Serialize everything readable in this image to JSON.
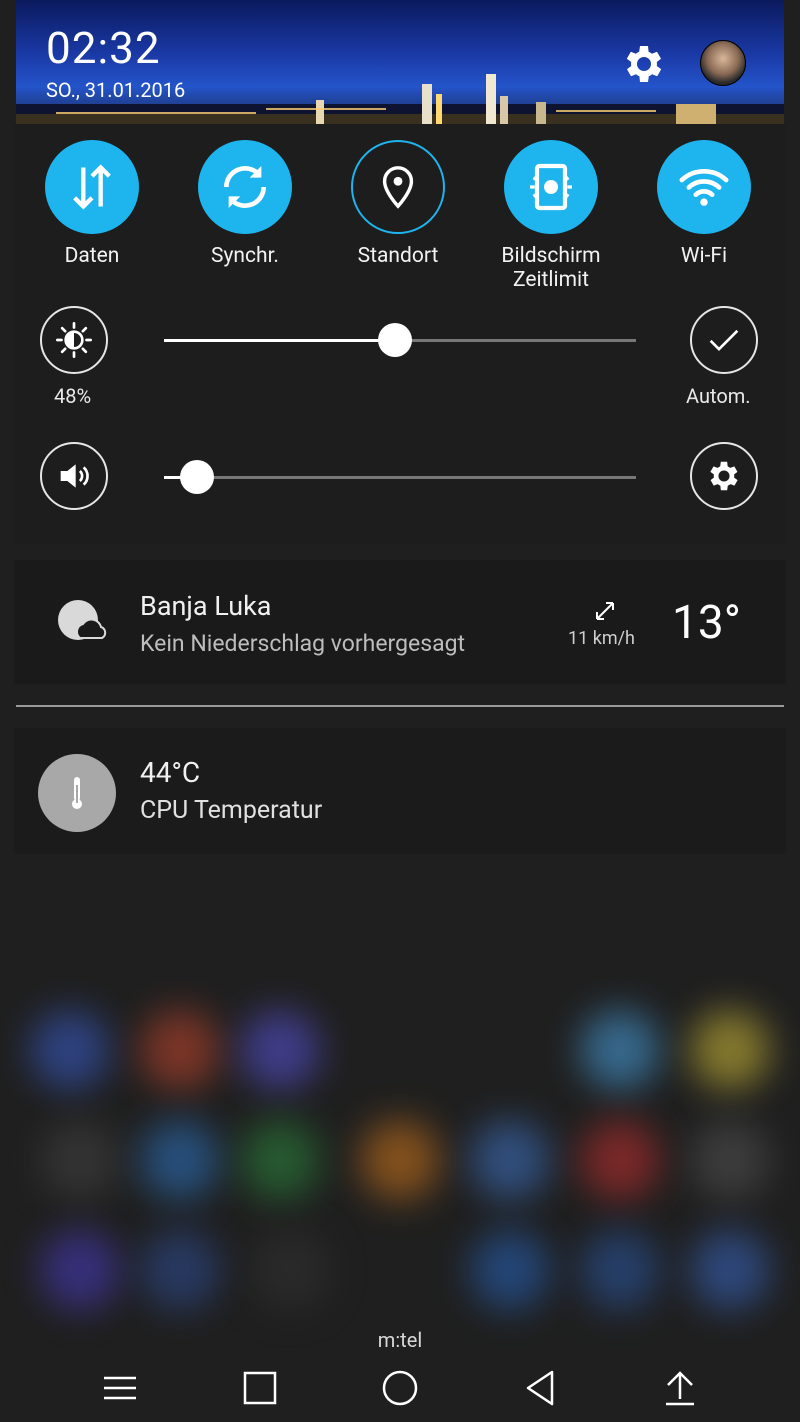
{
  "status": {
    "time": "02:32",
    "date": "SO., 31.01.2016"
  },
  "quick_toggles": [
    {
      "label": "Daten",
      "icon": "data-arrows-icon",
      "active": true
    },
    {
      "label": "Synchr.",
      "icon": "sync-icon",
      "active": true
    },
    {
      "label": "Standort",
      "icon": "location-pin-icon",
      "active": false
    },
    {
      "label": "Bildschirm\nZeitlimit",
      "icon": "screen-timeout-icon",
      "active": true
    },
    {
      "label": "Wi-Fi",
      "icon": "wifi-icon",
      "active": true
    }
  ],
  "brightness": {
    "percent_label": "48%",
    "level": 0.49,
    "auto_label": "Autom."
  },
  "volume": {
    "level": 0.07
  },
  "weather": {
    "city": "Banja Luka",
    "description": "Kein Niederschlag vorhergesagt",
    "wind": "11 km/h",
    "temperature": "13°"
  },
  "cpu": {
    "temperature": "44°C",
    "label": "CPU Temperatur"
  },
  "carrier": "m:tel",
  "colors": {
    "accent": "#1eb4ee",
    "panel": "#1d1d1d",
    "background": "#1c1c1c"
  },
  "navbar": [
    "menu-icon",
    "recents-square-icon",
    "home-circle-icon",
    "back-triangle-icon",
    "upload-arrow-icon"
  ]
}
